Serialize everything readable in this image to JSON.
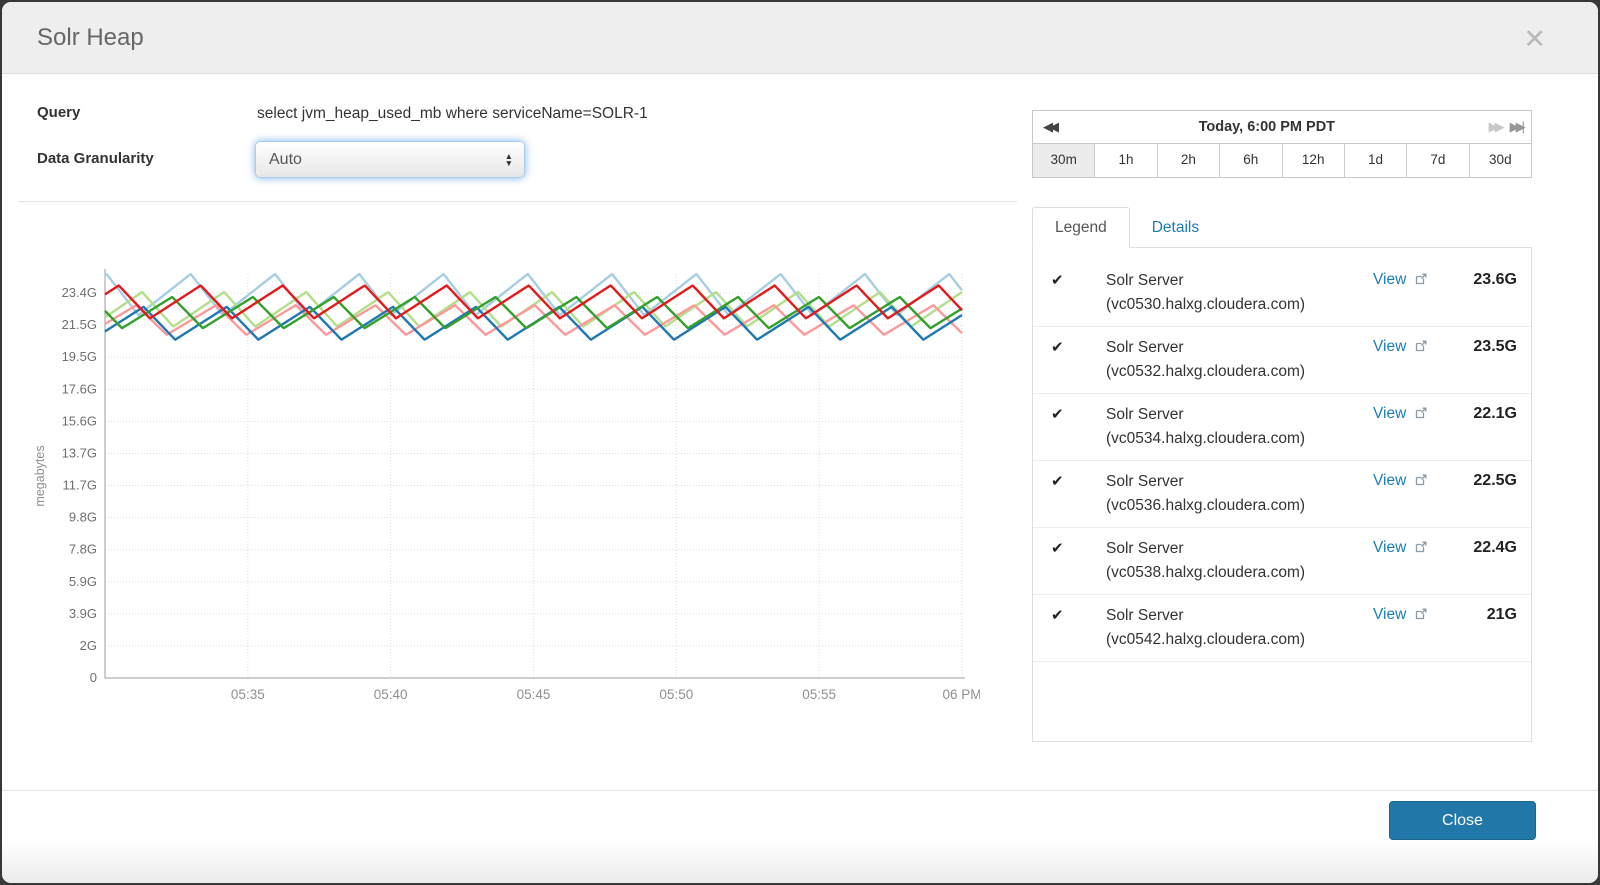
{
  "window": {
    "title": "Solr Heap",
    "close_icon": "✕"
  },
  "controls": {
    "query_label": "Query",
    "query_value": "select jvm_heap_used_mb where serviceName=SOLR-1",
    "granularity_label": "Data Granularity",
    "granularity_value": "Auto",
    "stepper_up_icon": "▲",
    "stepper_down_icon": "▼"
  },
  "timerange": {
    "current": "Today, 6:00 PM PDT",
    "rewind_icon": "◀◀",
    "forward_icon": "▶▶",
    "skip_end_icon": "▶▶|",
    "buttons": [
      "30m",
      "1h",
      "2h",
      "6h",
      "12h",
      "1d",
      "7d",
      "30d"
    ],
    "selected": "30m"
  },
  "tabs": {
    "legend": "Legend",
    "details": "Details",
    "active": "Legend"
  },
  "legend": {
    "check_glyph": "✔",
    "view_label": "View",
    "items": [
      {
        "checked": true,
        "color": "#a6cee3",
        "name": "Solr Server",
        "host": "(vc0530.halxg.cloudera.com)",
        "value": "23.6G"
      },
      {
        "checked": true,
        "color": "#b2df8a",
        "name": "Solr Server",
        "host": "(vc0532.halxg.cloudera.com)",
        "value": "23.5G"
      },
      {
        "checked": true,
        "color": "#1f78b4",
        "name": "Solr Server",
        "host": "(vc0534.halxg.cloudera.com)",
        "value": "22.1G"
      },
      {
        "checked": true,
        "color": "#33a02c",
        "name": "Solr Server",
        "host": "(vc0536.halxg.cloudera.com)",
        "value": "22.5G"
      },
      {
        "checked": true,
        "color": "#e31a1c",
        "name": "Solr Server",
        "host": "(vc0538.halxg.cloudera.com)",
        "value": "22.4G"
      },
      {
        "checked": true,
        "color": "#fb9a99",
        "name": "Solr Server",
        "host": "(vc0542.halxg.cloudera.com)",
        "value": "21G"
      }
    ]
  },
  "footer": {
    "close_label": "Close"
  },
  "colors": {
    "link_blue": "#1b7db5",
    "close_button": "#2177a8",
    "grid": "#dddddd",
    "axis": "#999999"
  },
  "chart_data": {
    "type": "line",
    "title": "Solr Heap (jvm_heap_used_mb)",
    "ylabel": "megabytes",
    "xlabel": "",
    "grid": true,
    "legend_position": "right-panel",
    "pattern": "sawtooth JVM garbage-collection oscillation per host",
    "ylim_gb": [
      0,
      24.6
    ],
    "x_range_minutes": [
      0,
      30
    ],
    "x_window": "17:30 to 18:00 (Today, 6:00 PM PDT)",
    "y_ticks": [
      {
        "label": "0",
        "gb": 0
      },
      {
        "label": "2G",
        "gb": 1.953
      },
      {
        "label": "3.9G",
        "gb": 3.906
      },
      {
        "label": "5.9G",
        "gb": 5.859
      },
      {
        "label": "7.8G",
        "gb": 7.813
      },
      {
        "label": "9.8G",
        "gb": 9.766
      },
      {
        "label": "11.7G",
        "gb": 11.719
      },
      {
        "label": "13.7G",
        "gb": 13.672
      },
      {
        "label": "15.6G",
        "gb": 15.625
      },
      {
        "label": "17.6G",
        "gb": 17.578
      },
      {
        "label": "19.5G",
        "gb": 19.531
      },
      {
        "label": "21.5G",
        "gb": 21.484
      },
      {
        "label": "23.4G",
        "gb": 23.438
      }
    ],
    "x_ticks": [
      {
        "label": "05:35",
        "min": 5
      },
      {
        "label": "05:40",
        "min": 10
      },
      {
        "label": "05:45",
        "min": 15
      },
      {
        "label": "05:50",
        "min": 20
      },
      {
        "label": "05:55",
        "min": 25
      },
      {
        "label": "06 PM",
        "min": 30
      }
    ],
    "series": [
      {
        "name": "Solr Server (vc0530.halxg.cloudera.com)",
        "color": "#a6cee3",
        "min_gb": 22.1,
        "max_gb": 24.6,
        "period_min": 2.95,
        "phase_min": 1.777,
        "latest": "23.6G"
      },
      {
        "name": "Solr Server (vc0532.halxg.cloudera.com)",
        "color": "#b2df8a",
        "min_gb": 21.4,
        "max_gb": 23.5,
        "period_min": 2.87,
        "phase_min": 0.479,
        "latest": "23.5G"
      },
      {
        "name": "Solr Server (vc0542.halxg.cloudera.com)",
        "color": "#fb9a99",
        "min_gb": 20.9,
        "max_gb": 22.7,
        "period_min": 2.79,
        "phase_min": 0.631,
        "latest": "21G"
      },
      {
        "name": "Solr Server (vc0534.halxg.cloudera.com)",
        "color": "#1f78b4",
        "min_gb": 20.6,
        "max_gb": 22.6,
        "period_min": 2.91,
        "phase_min": 0.453,
        "latest": "22.1G"
      },
      {
        "name": "Solr Server (vc0536.halxg.cloudera.com)",
        "color": "#33a02c",
        "min_gb": 21.3,
        "max_gb": 23.2,
        "period_min": 2.83,
        "phase_min": 2.234,
        "latest": "22.5G"
      },
      {
        "name": "Solr Server (vc0538.halxg.cloudera.com)",
        "color": "#e31a1c",
        "min_gb": 21.9,
        "max_gb": 23.9,
        "period_min": 2.87,
        "phase_min": 1.297,
        "latest": "22.4G"
      }
    ],
    "rise_fraction": 0.62
  }
}
